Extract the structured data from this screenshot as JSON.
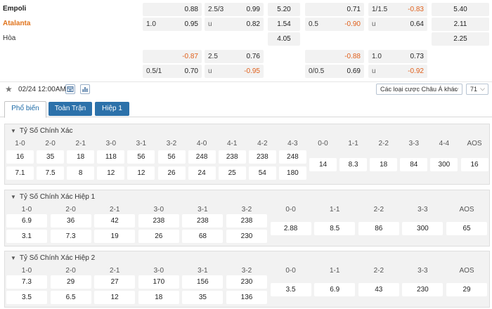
{
  "teams": {
    "home": "Empoli",
    "away": "Atalanta",
    "draw": "Hòa"
  },
  "odds_rows": [
    {
      "hcap_l": "",
      "hcap_r": "0.88",
      "ou_l": "2.5/3",
      "ou_r": "0.99",
      "x12": "5.20",
      "h2_l": "",
      "h2_r": "0.71",
      "ou2_l": "1/1.5",
      "ou2_r": "-0.83",
      "x12b": "5.40"
    },
    {
      "hcap_l": "1.0",
      "hcap_r": "0.95",
      "ou_l": "u",
      "ou_r": "0.82",
      "x12": "1.54",
      "h2_l": "0.5",
      "h2_r": "-0.90",
      "ou2_l": "u",
      "ou2_r": "0.64",
      "x12b": "2.11"
    },
    {
      "x12": "4.05",
      "x12b": "2.25"
    },
    {
      "hcap_l": "",
      "hcap_r": "-0.87",
      "ou_l": "2.5",
      "ou_r": "0.76",
      "h2_l": "",
      "h2_r": "-0.88",
      "ou2_l": "1.0",
      "ou2_r": "0.73"
    },
    {
      "hcap_l": "0.5/1",
      "hcap_r": "0.70",
      "ou_l": "u",
      "ou_r": "-0.95",
      "h2_l": "0/0.5",
      "h2_r": "0.69",
      "ou2_l": "u",
      "ou2_r": "-0.92"
    }
  ],
  "toolbar": {
    "date": "02/24 12:00AM",
    "select_label": "Các loại cược Châu Á khác",
    "count": "71"
  },
  "tabs": [
    {
      "label": "Phổ biến"
    },
    {
      "label": "Toàn Trận"
    },
    {
      "label": "Hiệp 1"
    }
  ],
  "markets": [
    {
      "title": "Tỷ Số Chính Xác",
      "headers": [
        "1-0",
        "2-0",
        "2-1",
        "3-0",
        "3-1",
        "3-2",
        "4-0",
        "4-1",
        "4-2",
        "4-3",
        "0-0",
        "1-1",
        "2-2",
        "3-3",
        "4-4",
        "AOS"
      ],
      "row1": [
        "16",
        "35",
        "18",
        "118",
        "56",
        "56",
        "248",
        "238",
        "238",
        "248"
      ],
      "row2": [
        "7.1",
        "7.5",
        "8",
        "12",
        "12",
        "26",
        "24",
        "25",
        "54",
        "180"
      ],
      "mid": [
        "14",
        "8.3",
        "18",
        "84",
        "300",
        "16"
      ]
    },
    {
      "title": "Tỷ Số Chính Xác Hiệp 1",
      "headers": [
        "1-0",
        "2-0",
        "2-1",
        "3-0",
        "3-1",
        "3-2",
        "0-0",
        "1-1",
        "2-2",
        "3-3",
        "AOS"
      ],
      "row1": [
        "6.9",
        "36",
        "42",
        "238",
        "238",
        "238"
      ],
      "row2": [
        "3.1",
        "7.3",
        "19",
        "26",
        "68",
        "230"
      ],
      "mid": [
        "2.88",
        "8.5",
        "86",
        "300",
        "65"
      ]
    },
    {
      "title": "Tỷ Số Chính Xác Hiệp 2",
      "headers": [
        "1-0",
        "2-0",
        "2-1",
        "3-0",
        "3-1",
        "3-2",
        "0-0",
        "1-1",
        "2-2",
        "3-3",
        "AOS"
      ],
      "row1": [
        "7.3",
        "29",
        "27",
        "170",
        "156",
        "230"
      ],
      "row2": [
        "3.5",
        "6.5",
        "12",
        "18",
        "35",
        "136"
      ],
      "mid": [
        "3.5",
        "6.9",
        "43",
        "230",
        "29"
      ]
    }
  ],
  "colors": {
    "accent": "#2c71aa",
    "negative": "#e0601c",
    "away_team": "#e0731c"
  }
}
